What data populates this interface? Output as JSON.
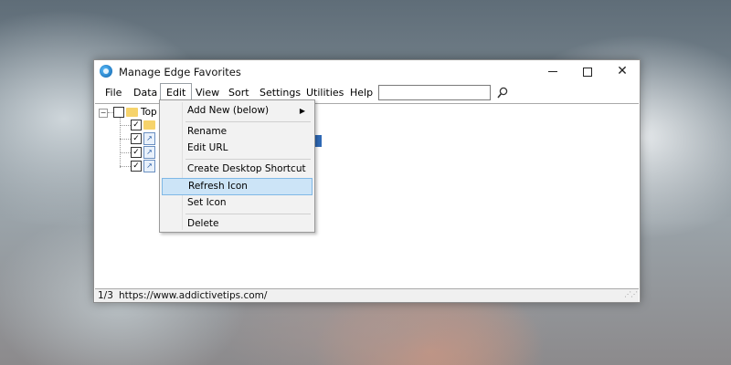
{
  "window": {
    "title": "Manage Edge Favorites",
    "close_glyph": "✕"
  },
  "menubar": {
    "items": [
      "File",
      "Data",
      "Edit",
      "View",
      "Sort",
      "Settings",
      "Utilities",
      "Help"
    ],
    "active": "Edit",
    "search": {
      "value": "",
      "placeholder": ""
    }
  },
  "tree": {
    "root_label": "Top",
    "expander": "−"
  },
  "edit_menu": {
    "items": [
      {
        "label": "Add New (below)",
        "submenu": true
      },
      {
        "label": "Rename"
      },
      {
        "label": "Edit URL"
      },
      {
        "label": "Create Desktop Shortcut"
      },
      {
        "label": "Refresh Icon",
        "highlighted": true
      },
      {
        "label": "Set Icon"
      },
      {
        "label": "Delete"
      }
    ],
    "submenu_arrow": "▶"
  },
  "statusbar": {
    "count": "1/3",
    "url": "https://www.addictivetips.com/"
  },
  "colors": {
    "highlight_bg": "#cce4f7",
    "highlight_border": "#7fb8e6",
    "selection": "#2f69b5"
  },
  "icons": [
    "app-logo-icon",
    "minimize-icon",
    "maximize-icon",
    "close-icon",
    "search-icon",
    "folder-icon",
    "favorite-link-icon",
    "submenu-arrow-icon"
  ]
}
